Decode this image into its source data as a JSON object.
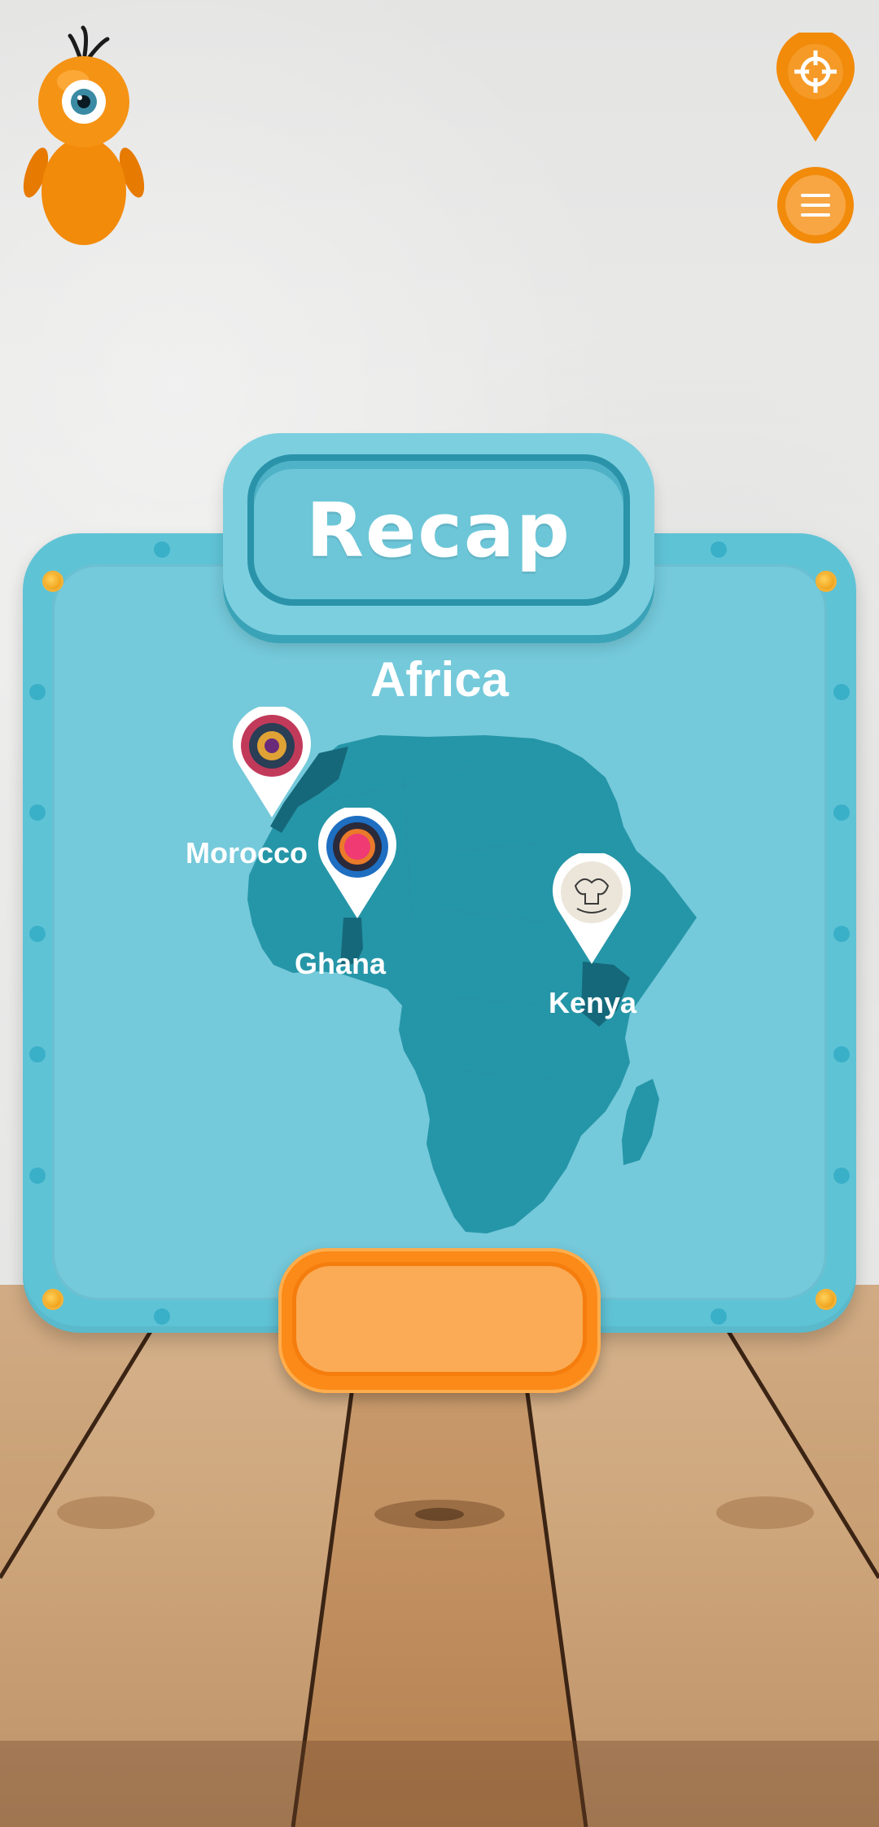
{
  "header": {
    "mascot_icon": "orange-cyclops-mascot-icon",
    "locate_icon": "location-crosshair-icon",
    "menu_icon": "hamburger-menu-icon"
  },
  "board": {
    "title": "Recap",
    "continent": "Africa",
    "pins": [
      {
        "label": "Morocco",
        "icon": "mandala-red-pattern-icon"
      },
      {
        "label": "Ghana",
        "icon": "mandala-blue-pink-icon"
      },
      {
        "label": "Kenya",
        "icon": "ornate-elephant-pattern-icon"
      }
    ]
  },
  "action_button": {
    "label": ""
  },
  "colors": {
    "board": "#74c9da",
    "board_frame": "#5fc3d6",
    "map": "#2596a8",
    "map_highlight": "#15687a",
    "accent_orange": "#fb8a18",
    "label_white": "#ffffff"
  }
}
